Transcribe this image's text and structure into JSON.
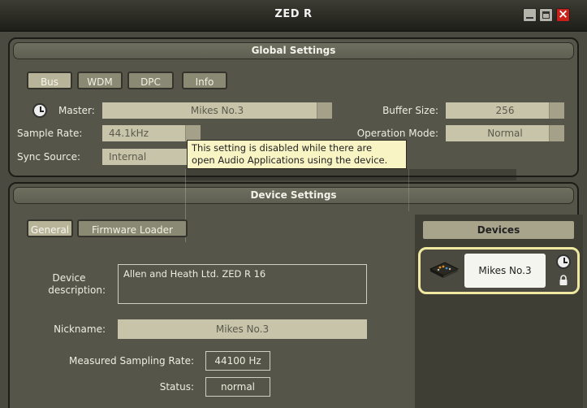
{
  "window": {
    "title": "ZED R"
  },
  "global": {
    "header": "Global Settings",
    "tabs": [
      "Bus",
      "WDM",
      "DPC",
      "Info"
    ],
    "master_label": "Master:",
    "master_value": "Mikes No.3",
    "buffer_label": "Buffer Size:",
    "buffer_value": "256",
    "sample_rate_label": "Sample Rate:",
    "sample_rate_value": "44.1kHz",
    "op_mode_label": "Operation Mode:",
    "op_mode_value": "Normal",
    "sync_label": "Sync Source:",
    "sync_value": "Internal",
    "tooltip_line1": "This setting is disabled while there are",
    "tooltip_line2": "open Audio Applications using the device."
  },
  "device": {
    "header": "Device Settings",
    "tabs": [
      "General",
      "Firmware Loader"
    ],
    "desc_label_1": "Device",
    "desc_label_2": "description:",
    "desc_value": "Allen and Heath Ltd. ZED R 16",
    "nickname_label": "Nickname:",
    "nickname_value": "Mikes No.3",
    "measured_label": "Measured Sampling Rate:",
    "measured_value": "44100 Hz",
    "status_label": "Status:",
    "status_value": "normal"
  },
  "devices": {
    "header": "Devices",
    "card_name": "Mikes No.3"
  },
  "colors": {
    "accent_outline": "#f0e8a0",
    "close_button": "#c9201a"
  }
}
